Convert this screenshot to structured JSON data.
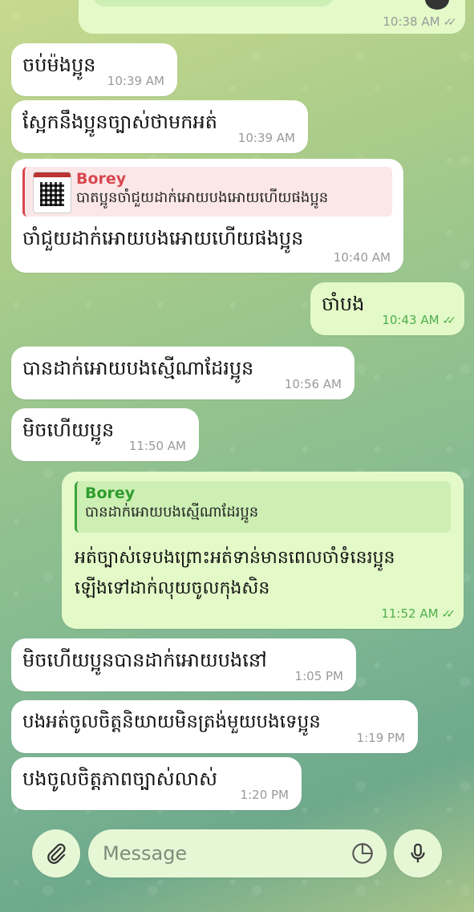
{
  "chat": {
    "top_partial": {
      "time": "10:38 AM",
      "status": "read"
    },
    "messages": [
      {
        "dir": "in",
        "text": "ចប់ម៉ងប្អូន",
        "time": "10:39 AM"
      },
      {
        "dir": "in",
        "text": "ស្អែកនឹងប្អូនច្បាស់ថាមកអត់",
        "time": "10:39 AM"
      },
      {
        "dir": "in",
        "reply_name": "Borey",
        "reply_text": "បាតប្អូនចាំជួយដាក់អោយបងអោយហើយផងប្អូន",
        "text": "ចាំជួយដាក់អោយបងអោយហើយផងប្អូន",
        "time": "10:40 AM"
      },
      {
        "dir": "out",
        "text": "ចាំបង",
        "time": "10:43 AM"
      },
      {
        "dir": "in",
        "text": "បានដាក់អោយបងស្មើណាដែរប្អូន",
        "time": "10:56 AM"
      },
      {
        "dir": "in",
        "text": "មិចហើយប្អូន",
        "time": "11:50 AM"
      },
      {
        "dir": "out",
        "reply_name": "Borey",
        "reply_text": "បានដាក់អោយបងស្មើណាដែរប្អូន",
        "text_line1": "អត់ច្បាស់ទេបងព្រោះអត់ទាន់មានពេលចាំទំនេរប្អូន",
        "text_line2": "ឡើងទៅដាក់លុយចូលកុងសិន",
        "time": "11:52 AM"
      },
      {
        "dir": "in",
        "text": "មិចហើយប្អូនបានដាក់អោយបងនៅ",
        "time": "1:05 PM"
      },
      {
        "dir": "in",
        "text": "បងអត់ចូលចិត្តនិយាយមិនត្រង់មួយបងទេប្អូន",
        "time": "1:19 PM"
      },
      {
        "dir": "in",
        "text": "បងចូលចិត្តភាពច្បាស់លាស់",
        "time": "1:20 PM"
      }
    ]
  },
  "composer": {
    "placeholder": "Message",
    "attach_icon": "paperclip-icon",
    "sticker_icon": "sticker-icon",
    "mic_icon": "microphone-icon"
  },
  "colors": {
    "incoming": "#ffffff",
    "outgoing": "#e3fac8",
    "outgoing_time": "#4fae4e",
    "reply_red": "#d8474f",
    "reply_green": "#2e9d2e"
  }
}
